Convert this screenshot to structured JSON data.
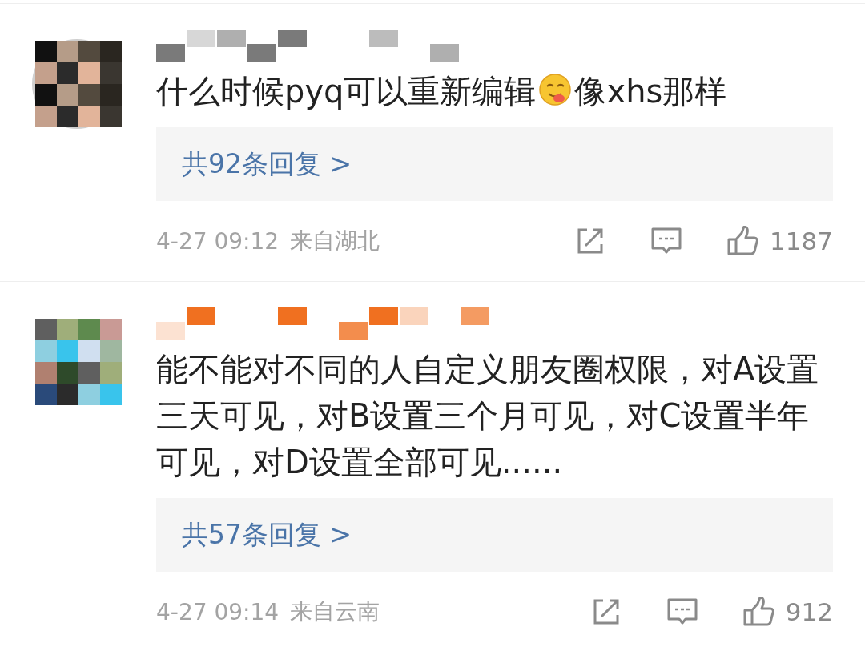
{
  "comments": [
    {
      "avatar": {
        "kind": "picture"
      },
      "name_mosaic": {
        "color": "#7a7a7a"
      },
      "text_parts": [
        {
          "kind": "text",
          "text": "什么时候pyq可以重新编辑"
        },
        {
          "kind": "emoji"
        },
        {
          "kind": "text",
          "text": "像xhs那样"
        }
      ],
      "replies": "共92条回复 >",
      "time": "4-27 09:12",
      "location": "来自湖北",
      "likes": "1187"
    },
    {
      "avatar": {
        "kind": "picture"
      },
      "name_mosaic": {
        "color": "#f07020"
      },
      "text_parts": [
        {
          "kind": "text",
          "text": "能不能对不同的人自定义朋友圈权限，对A设置三天可见，对B设置三个月可见，对C设置半年可见，对D设置全部可见......"
        }
      ],
      "replies": "共57条回复 >",
      "time": "4-27 09:14",
      "location": "来自云南",
      "likes": "912"
    }
  ]
}
